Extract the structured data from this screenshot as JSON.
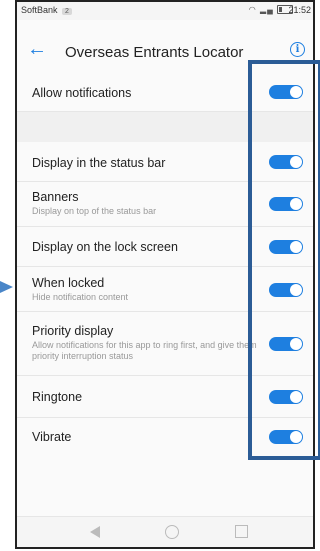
{
  "status_bar": {
    "carrier": "SoftBank",
    "sim_badge": "2",
    "time": "21:52"
  },
  "header": {
    "title": "Overseas Entrants Locator"
  },
  "settings": [
    {
      "label": "Allow notifications",
      "enabled": true
    },
    {
      "label": "Display in the status bar",
      "enabled": true
    },
    {
      "label": "Banners",
      "sublabel": "Display on top of the status bar",
      "enabled": true
    },
    {
      "label": "Display on the lock screen",
      "enabled": true
    },
    {
      "label": "When locked",
      "sublabel": "Hide notification content",
      "enabled": true
    },
    {
      "label": "Priority display",
      "sublabel": "Allow notifications for this app to ring first, and give them priority interruption status",
      "enabled": true
    },
    {
      "label": "Ringtone",
      "enabled": true
    },
    {
      "label": "Vibrate",
      "enabled": true
    }
  ],
  "colors": {
    "accent": "#1e7fe0",
    "highlight": "#2b5c96",
    "pointer": "#4a86c8"
  }
}
